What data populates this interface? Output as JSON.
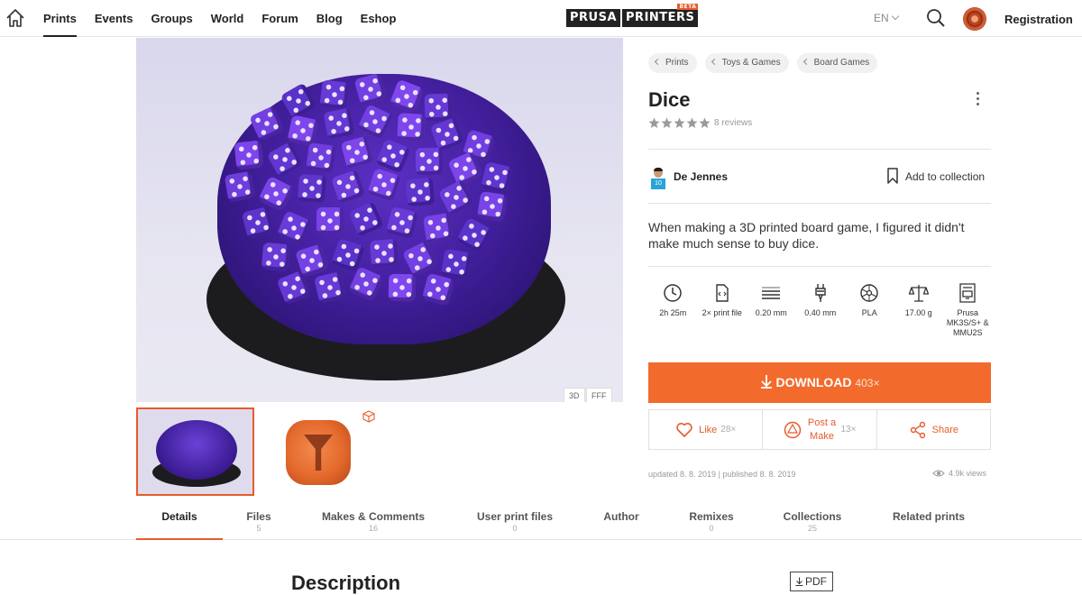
{
  "nav": {
    "items": [
      {
        "label": "Prints",
        "active": true
      },
      {
        "label": "Events"
      },
      {
        "label": "Groups"
      },
      {
        "label": "World"
      },
      {
        "label": "Forum"
      },
      {
        "label": "Blog"
      },
      {
        "label": "Eshop"
      }
    ],
    "logo_left": "PRUSA",
    "logo_right": "PRINTERS",
    "logo_badge": "BETA",
    "language": "EN",
    "registration": "Registration"
  },
  "gallery": {
    "tag_3d": "3D",
    "tag_fff": "FFF"
  },
  "breadcrumb": [
    "Prints",
    "Toys & Games",
    "Board Games"
  ],
  "print": {
    "title": "Dice",
    "rating": 5,
    "reviews": "8 reviews",
    "author": "De Jennes",
    "author_level": "10",
    "add_to_collection": "Add to collection",
    "summary": "When making a 3D printed board game, I figured it didn't make much sense to buy dice."
  },
  "params": [
    {
      "icon": "clock-icon",
      "label": "2h 25m"
    },
    {
      "icon": "file-icon",
      "label": "2× print file"
    },
    {
      "icon": "layer-height-icon",
      "label": "0.20 mm"
    },
    {
      "icon": "nozzle-icon",
      "label": "0.40 mm"
    },
    {
      "icon": "filament-spool-icon",
      "label": "PLA"
    },
    {
      "icon": "scale-icon",
      "label": "17.00 g"
    },
    {
      "icon": "printer-icon",
      "label": "Prusa MK3S/S+ & MMU2S"
    }
  ],
  "download": {
    "label": "DOWNLOAD",
    "count": "403×"
  },
  "actions": {
    "like_label": "Like",
    "like_count": "28×",
    "make_label": "Post a Make",
    "make_count": "13×",
    "share_label": "Share"
  },
  "meta": {
    "updated": "updated 8. 8. 2019",
    "separator": "|",
    "published": "published 8. 8. 2019",
    "views": "4.9k views"
  },
  "tabs": [
    {
      "label": "Details",
      "count": ""
    },
    {
      "label": "Files",
      "count": "5"
    },
    {
      "label": "Makes & Comments",
      "count": "16"
    },
    {
      "label": "User print files",
      "count": "0"
    },
    {
      "label": "Author",
      "count": ""
    },
    {
      "label": "Remixes",
      "count": "0"
    },
    {
      "label": "Collections",
      "count": "25"
    },
    {
      "label": "Related prints",
      "count": ""
    }
  ],
  "description": {
    "heading": "Description",
    "pdf_label": "PDF"
  },
  "colors": {
    "accent": "#e75b2b",
    "download": "#f26b2c"
  }
}
